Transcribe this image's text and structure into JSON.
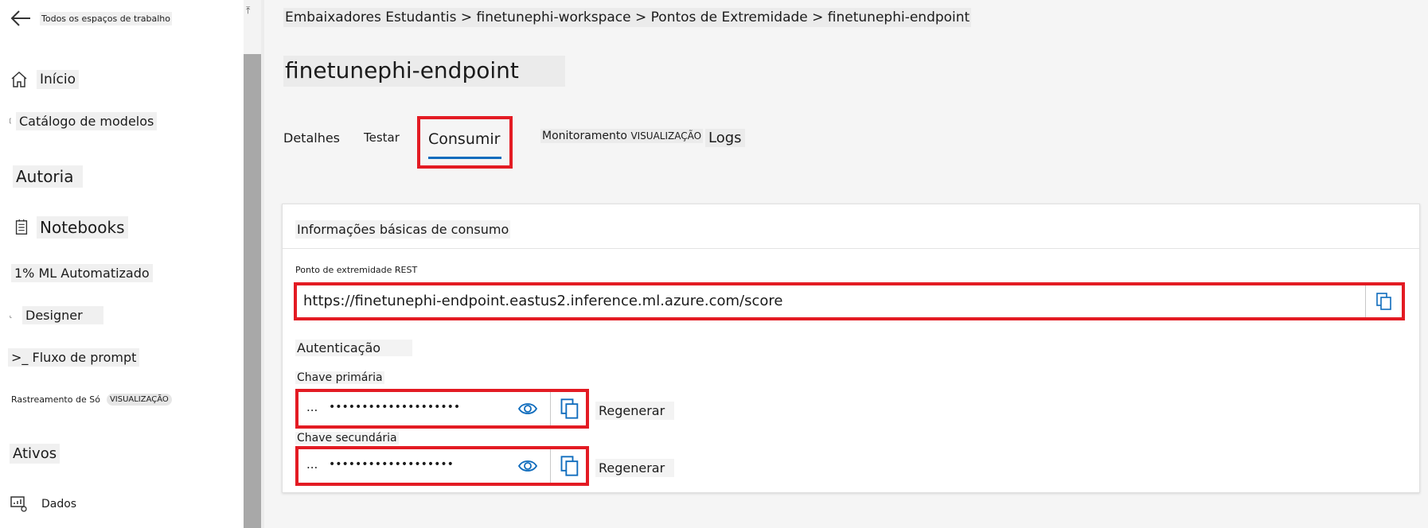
{
  "sidebar": {
    "back_label": "Todos os espaços de trabalho",
    "items": [
      {
        "label": "Início",
        "icon": "home-icon"
      },
      {
        "label": "Catálogo de modelos",
        "icon": "catalog-icon"
      },
      {
        "label": "Autoria",
        "icon": ""
      },
      {
        "label": "Notebooks",
        "icon": "notebook-icon"
      },
      {
        "label": "1% ML Automatizado",
        "icon": ""
      },
      {
        "label": "Designer",
        "icon": "designer-icon"
      },
      {
        "label": ">_ Fluxo de prompt",
        "icon": ""
      },
      {
        "label": "Rastreamento de Só",
        "badge": "VISUALIZAÇÃO",
        "icon": ""
      },
      {
        "label": "Ativos",
        "icon": ""
      },
      {
        "label": "Dados",
        "icon": "data-icon"
      }
    ]
  },
  "breadcrumb": "Embaixadores Estudantis > finetunephi-workspace > Pontos de Extremidade > finetunephi-endpoint",
  "page_title": "finetunephi-endpoint",
  "tabs": {
    "details": "Detalhes",
    "test": "Testar",
    "consume": "Consumir",
    "monitor": "Monitoramento",
    "monitor_badge": "VISUALIZAÇÃO",
    "logs": "Logs"
  },
  "card": {
    "title": "Informações básicas de consumo",
    "rest_label": "Ponto de extremidade REST",
    "rest_url": "https://finetunephi-endpoint.eastus2.inference.ml.azure.com/score",
    "auth_label": "Autenticação",
    "primary_label": "Chave primária",
    "secondary_label": "Chave secundária",
    "key_prefix": "...",
    "primary_mask": "••••••••••••••••••••",
    "secondary_mask": "•••••••••••••••••••",
    "regenerate": "Regenerar"
  },
  "colors": {
    "highlight": "#e31b23",
    "accent": "#0f6cbd"
  }
}
